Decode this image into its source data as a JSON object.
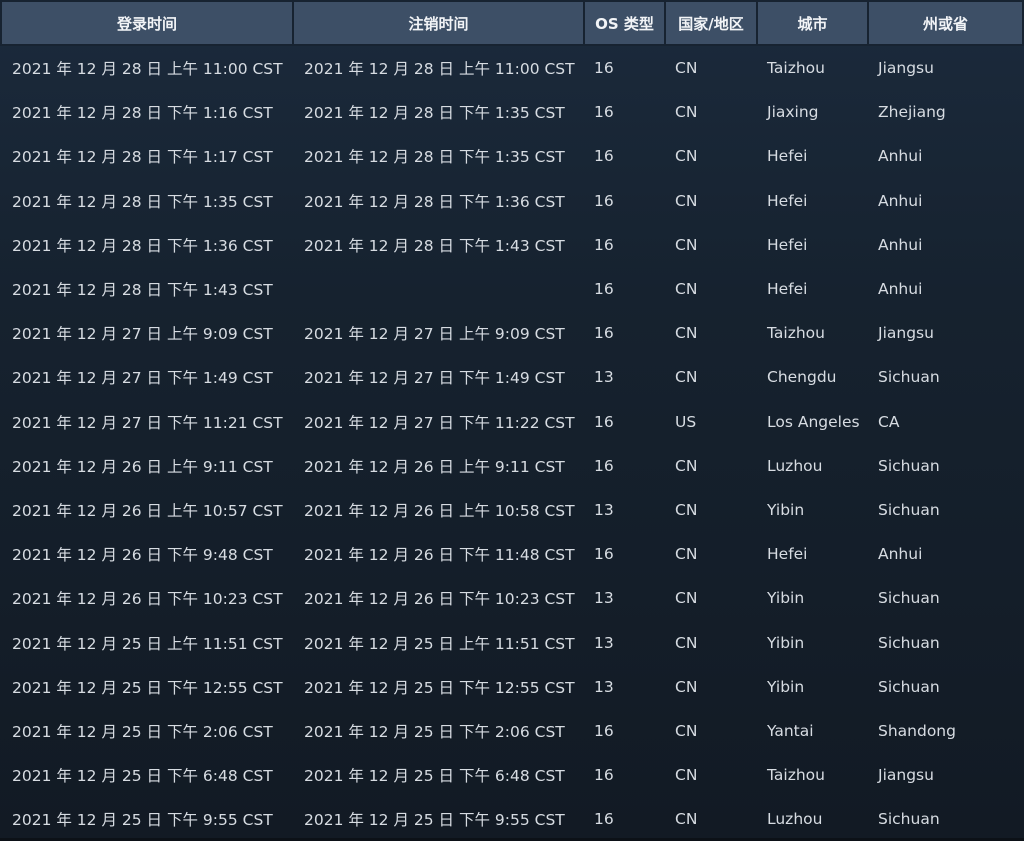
{
  "table": {
    "headers": {
      "login": "登录时间",
      "logout": "注销时间",
      "os": "OS 类型",
      "country": "国家/地区",
      "city": "城市",
      "state": "州或省"
    },
    "rows": [
      {
        "login": "2021 年 12 月 28 日 上午 11:00 CST",
        "logout": "2021 年 12 月 28 日 上午 11:00 CST",
        "os": "16",
        "country": "CN",
        "city": "Taizhou",
        "state": "Jiangsu"
      },
      {
        "login": "2021 年 12 月 28 日 下午 1:16 CST",
        "logout": "2021 年 12 月 28 日 下午 1:35 CST",
        "os": "16",
        "country": "CN",
        "city": "Jiaxing",
        "state": "Zhejiang"
      },
      {
        "login": "2021 年 12 月 28 日 下午 1:17 CST",
        "logout": "2021 年 12 月 28 日 下午 1:35 CST",
        "os": "16",
        "country": "CN",
        "city": "Hefei",
        "state": "Anhui"
      },
      {
        "login": "2021 年 12 月 28 日 下午 1:35 CST",
        "logout": "2021 年 12 月 28 日 下午 1:36 CST",
        "os": "16",
        "country": "CN",
        "city": "Hefei",
        "state": "Anhui"
      },
      {
        "login": "2021 年 12 月 28 日 下午 1:36 CST",
        "logout": "2021 年 12 月 28 日 下午 1:43 CST",
        "os": "16",
        "country": "CN",
        "city": "Hefei",
        "state": "Anhui"
      },
      {
        "login": "2021 年 12 月 28 日 下午 1:43 CST",
        "logout": "",
        "os": "16",
        "country": "CN",
        "city": "Hefei",
        "state": "Anhui"
      },
      {
        "login": "2021 年 12 月 27 日 上午 9:09 CST",
        "logout": "2021 年 12 月 27 日 上午 9:09 CST",
        "os": "16",
        "country": "CN",
        "city": "Taizhou",
        "state": "Jiangsu"
      },
      {
        "login": "2021 年 12 月 27 日 下午 1:49 CST",
        "logout": "2021 年 12 月 27 日 下午 1:49 CST",
        "os": "13",
        "country": "CN",
        "city": "Chengdu",
        "state": "Sichuan"
      },
      {
        "login": "2021 年 12 月 27 日 下午 11:21 CST",
        "logout": "2021 年 12 月 27 日 下午 11:22 CST",
        "os": "16",
        "country": "US",
        "city": "Los Angeles",
        "state": "CA"
      },
      {
        "login": "2021 年 12 月 26 日 上午 9:11 CST",
        "logout": "2021 年 12 月 26 日 上午 9:11 CST",
        "os": "16",
        "country": "CN",
        "city": "Luzhou",
        "state": "Sichuan"
      },
      {
        "login": "2021 年 12 月 26 日 上午 10:57 CST",
        "logout": "2021 年 12 月 26 日 上午 10:58 CST",
        "os": "13",
        "country": "CN",
        "city": "Yibin",
        "state": "Sichuan"
      },
      {
        "login": "2021 年 12 月 26 日 下午 9:48 CST",
        "logout": "2021 年 12 月 26 日 下午 11:48 CST",
        "os": "16",
        "country": "CN",
        "city": "Hefei",
        "state": "Anhui"
      },
      {
        "login": "2021 年 12 月 26 日 下午 10:23 CST",
        "logout": "2021 年 12 月 26 日 下午 10:23 CST",
        "os": "13",
        "country": "CN",
        "city": "Yibin",
        "state": "Sichuan"
      },
      {
        "login": "2021 年 12 月 25 日 上午 11:51 CST",
        "logout": "2021 年 12 月 25 日 上午 11:51 CST",
        "os": "13",
        "country": "CN",
        "city": "Yibin",
        "state": "Sichuan"
      },
      {
        "login": "2021 年 12 月 25 日 下午 12:55 CST",
        "logout": "2021 年 12 月 25 日 下午 12:55 CST",
        "os": "13",
        "country": "CN",
        "city": "Yibin",
        "state": "Sichuan"
      },
      {
        "login": "2021 年 12 月 25 日 下午 2:06 CST",
        "logout": "2021 年 12 月 25 日 下午 2:06 CST",
        "os": "16",
        "country": "CN",
        "city": "Yantai",
        "state": "Shandong"
      },
      {
        "login": "2021 年 12 月 25 日 下午 6:48 CST",
        "logout": "2021 年 12 月 25 日 下午 6:48 CST",
        "os": "16",
        "country": "CN",
        "city": "Taizhou",
        "state": "Jiangsu"
      },
      {
        "login": "2021 年 12 月 25 日 下午 9:55 CST",
        "logout": "2021 年 12 月 25 日 下午 9:55 CST",
        "os": "16",
        "country": "CN",
        "city": "Luzhou",
        "state": "Sichuan"
      }
    ]
  },
  "colors": {
    "header_bg": "#3d4f66",
    "page_bg": "#16222f",
    "text": "#d7dce2"
  }
}
